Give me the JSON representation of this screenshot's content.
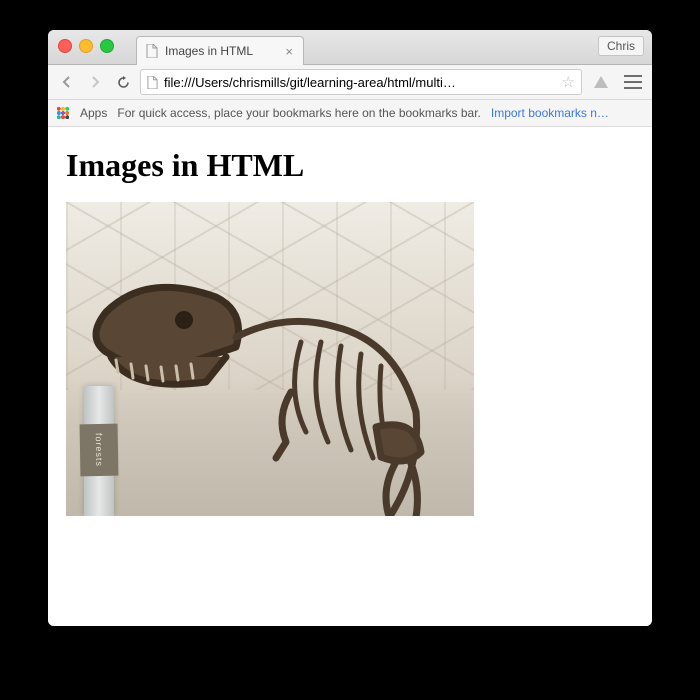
{
  "window": {
    "profile_name": "Chris"
  },
  "tab": {
    "title": "Images in HTML"
  },
  "toolbar": {
    "url": "file:///Users/chrismills/git/learning-area/html/multi…"
  },
  "bookmarks": {
    "apps_label": "Apps",
    "hint": "For quick access, place your bookmarks here on the bookmarks bar.",
    "import_label": "Import bookmarks n…"
  },
  "page": {
    "heading": "Images in HTML",
    "image_alt": "A T-Rex skeleton on display in a museum hall",
    "plaque_text": "forests"
  }
}
